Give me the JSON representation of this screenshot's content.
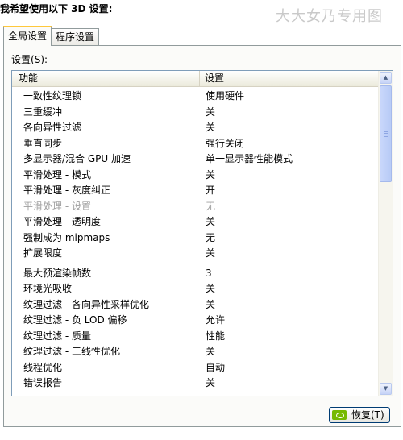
{
  "heading": "我希望使用以下 3D 设置:",
  "watermark": "大大女乃专用图",
  "tabs": [
    {
      "label": "全局设置",
      "active": true
    },
    {
      "label": "程序设置",
      "active": false
    }
  ],
  "settings_label": "设置(",
  "settings_label_key": "S",
  "settings_label_end": "):",
  "columns": {
    "feature": "功能",
    "setting": "设置"
  },
  "rows": [
    {
      "feature": "一致性纹理锁",
      "value": "使用硬件"
    },
    {
      "feature": "三重缓冲",
      "value": "关"
    },
    {
      "feature": "各向异性过滤",
      "value": "关"
    },
    {
      "feature": "垂直同步",
      "value": "强行关闭"
    },
    {
      "feature": "多显示器/混合 GPU 加速",
      "value": "单一显示器性能模式"
    },
    {
      "feature": "平滑处理 - 模式",
      "value": "关"
    },
    {
      "feature": "平滑处理 - 灰度纠正",
      "value": "开"
    },
    {
      "feature": "平滑处理 - 设置",
      "value": "无",
      "disabled": true
    },
    {
      "feature": "平滑处理 - 透明度",
      "value": "关"
    },
    {
      "feature": "强制成为 mipmaps",
      "value": "无"
    },
    {
      "feature": "扩展限度",
      "value": "关"
    },
    {
      "feature": "最大预渲染帧数",
      "value": "3",
      "gap": true
    },
    {
      "feature": "环境光吸收",
      "value": "关"
    },
    {
      "feature": "纹理过滤 - 各向异性采样优化",
      "value": "关"
    },
    {
      "feature": "纹理过滤 - 负 LOD 偏移",
      "value": "允许"
    },
    {
      "feature": "纹理过滤 - 质量",
      "value": "性能"
    },
    {
      "feature": "纹理过滤 - 三线性优化",
      "value": "关"
    },
    {
      "feature": "线程优化",
      "value": "自动"
    },
    {
      "feature": "错误报告",
      "value": "关"
    }
  ],
  "restore_button": "恢复(T)",
  "icons": {
    "restore": "nvidia-icon",
    "scroll_up": "arrow-up-icon",
    "scroll_down": "arrow-down-icon"
  },
  "colors": {
    "tab_accent": "#ffc83c",
    "nvidia_green": "#76b900",
    "disabled_text": "#a0a0a0"
  }
}
